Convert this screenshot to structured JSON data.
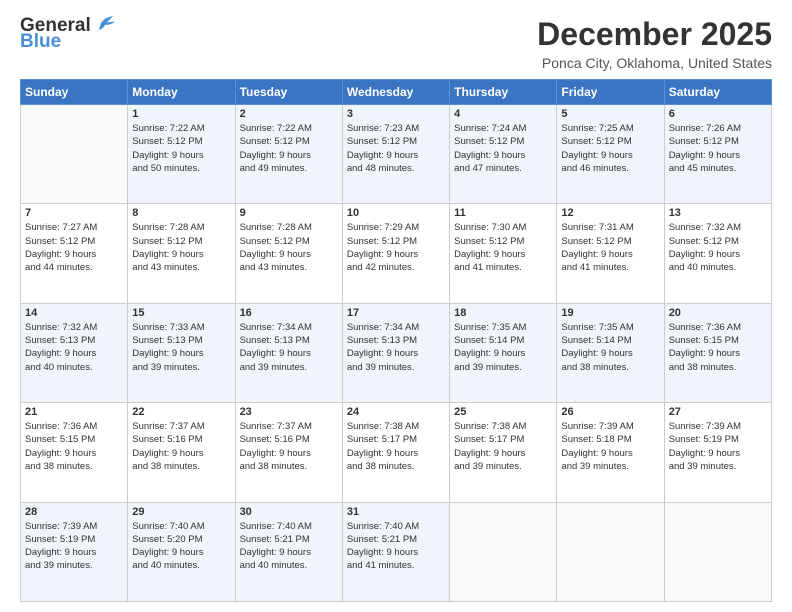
{
  "logo": {
    "line1": "General",
    "line2": "Blue"
  },
  "header": {
    "month": "December 2025",
    "location": "Ponca City, Oklahoma, United States"
  },
  "days_of_week": [
    "Sunday",
    "Monday",
    "Tuesday",
    "Wednesday",
    "Thursday",
    "Friday",
    "Saturday"
  ],
  "weeks": [
    [
      {
        "num": "",
        "info": ""
      },
      {
        "num": "1",
        "info": "Sunrise: 7:22 AM\nSunset: 5:12 PM\nDaylight: 9 hours\nand 50 minutes."
      },
      {
        "num": "2",
        "info": "Sunrise: 7:22 AM\nSunset: 5:12 PM\nDaylight: 9 hours\nand 49 minutes."
      },
      {
        "num": "3",
        "info": "Sunrise: 7:23 AM\nSunset: 5:12 PM\nDaylight: 9 hours\nand 48 minutes."
      },
      {
        "num": "4",
        "info": "Sunrise: 7:24 AM\nSunset: 5:12 PM\nDaylight: 9 hours\nand 47 minutes."
      },
      {
        "num": "5",
        "info": "Sunrise: 7:25 AM\nSunset: 5:12 PM\nDaylight: 9 hours\nand 46 minutes."
      },
      {
        "num": "6",
        "info": "Sunrise: 7:26 AM\nSunset: 5:12 PM\nDaylight: 9 hours\nand 45 minutes."
      }
    ],
    [
      {
        "num": "7",
        "info": "Sunrise: 7:27 AM\nSunset: 5:12 PM\nDaylight: 9 hours\nand 44 minutes."
      },
      {
        "num": "8",
        "info": "Sunrise: 7:28 AM\nSunset: 5:12 PM\nDaylight: 9 hours\nand 43 minutes."
      },
      {
        "num": "9",
        "info": "Sunrise: 7:28 AM\nSunset: 5:12 PM\nDaylight: 9 hours\nand 43 minutes."
      },
      {
        "num": "10",
        "info": "Sunrise: 7:29 AM\nSunset: 5:12 PM\nDaylight: 9 hours\nand 42 minutes."
      },
      {
        "num": "11",
        "info": "Sunrise: 7:30 AM\nSunset: 5:12 PM\nDaylight: 9 hours\nand 41 minutes."
      },
      {
        "num": "12",
        "info": "Sunrise: 7:31 AM\nSunset: 5:12 PM\nDaylight: 9 hours\nand 41 minutes."
      },
      {
        "num": "13",
        "info": "Sunrise: 7:32 AM\nSunset: 5:12 PM\nDaylight: 9 hours\nand 40 minutes."
      }
    ],
    [
      {
        "num": "14",
        "info": "Sunrise: 7:32 AM\nSunset: 5:13 PM\nDaylight: 9 hours\nand 40 minutes."
      },
      {
        "num": "15",
        "info": "Sunrise: 7:33 AM\nSunset: 5:13 PM\nDaylight: 9 hours\nand 39 minutes."
      },
      {
        "num": "16",
        "info": "Sunrise: 7:34 AM\nSunset: 5:13 PM\nDaylight: 9 hours\nand 39 minutes."
      },
      {
        "num": "17",
        "info": "Sunrise: 7:34 AM\nSunset: 5:13 PM\nDaylight: 9 hours\nand 39 minutes."
      },
      {
        "num": "18",
        "info": "Sunrise: 7:35 AM\nSunset: 5:14 PM\nDaylight: 9 hours\nand 39 minutes."
      },
      {
        "num": "19",
        "info": "Sunrise: 7:35 AM\nSunset: 5:14 PM\nDaylight: 9 hours\nand 38 minutes."
      },
      {
        "num": "20",
        "info": "Sunrise: 7:36 AM\nSunset: 5:15 PM\nDaylight: 9 hours\nand 38 minutes."
      }
    ],
    [
      {
        "num": "21",
        "info": "Sunrise: 7:36 AM\nSunset: 5:15 PM\nDaylight: 9 hours\nand 38 minutes."
      },
      {
        "num": "22",
        "info": "Sunrise: 7:37 AM\nSunset: 5:16 PM\nDaylight: 9 hours\nand 38 minutes."
      },
      {
        "num": "23",
        "info": "Sunrise: 7:37 AM\nSunset: 5:16 PM\nDaylight: 9 hours\nand 38 minutes."
      },
      {
        "num": "24",
        "info": "Sunrise: 7:38 AM\nSunset: 5:17 PM\nDaylight: 9 hours\nand 38 minutes."
      },
      {
        "num": "25",
        "info": "Sunrise: 7:38 AM\nSunset: 5:17 PM\nDaylight: 9 hours\nand 39 minutes."
      },
      {
        "num": "26",
        "info": "Sunrise: 7:39 AM\nSunset: 5:18 PM\nDaylight: 9 hours\nand 39 minutes."
      },
      {
        "num": "27",
        "info": "Sunrise: 7:39 AM\nSunset: 5:19 PM\nDaylight: 9 hours\nand 39 minutes."
      }
    ],
    [
      {
        "num": "28",
        "info": "Sunrise: 7:39 AM\nSunset: 5:19 PM\nDaylight: 9 hours\nand 39 minutes."
      },
      {
        "num": "29",
        "info": "Sunrise: 7:40 AM\nSunset: 5:20 PM\nDaylight: 9 hours\nand 40 minutes."
      },
      {
        "num": "30",
        "info": "Sunrise: 7:40 AM\nSunset: 5:21 PM\nDaylight: 9 hours\nand 40 minutes."
      },
      {
        "num": "31",
        "info": "Sunrise: 7:40 AM\nSunset: 5:21 PM\nDaylight: 9 hours\nand 41 minutes."
      },
      {
        "num": "",
        "info": ""
      },
      {
        "num": "",
        "info": ""
      },
      {
        "num": "",
        "info": ""
      }
    ]
  ]
}
